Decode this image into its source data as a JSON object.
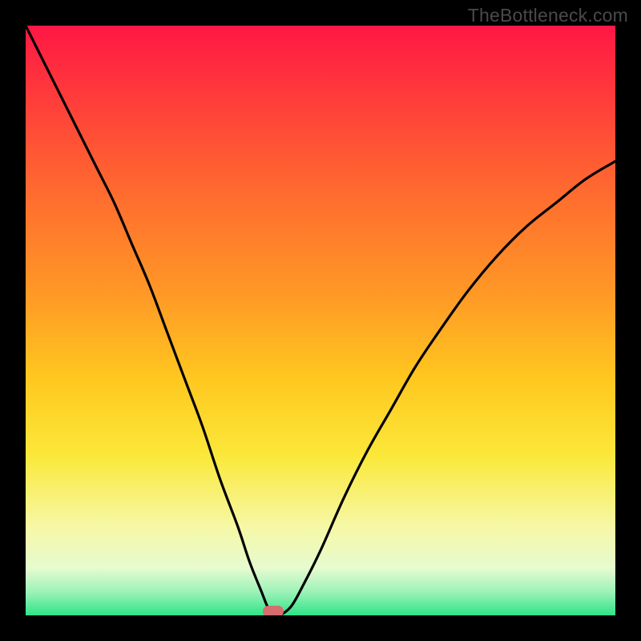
{
  "watermark": "TheBottleneck.com",
  "chart_data": {
    "type": "line",
    "title": "",
    "xlabel": "",
    "ylabel": "",
    "xlim": [
      0,
      100
    ],
    "ylim": [
      0,
      100
    ],
    "grid": false,
    "bottleneck_x": 42,
    "marker": {
      "x": 42,
      "y": 0,
      "color": "#d66e6e"
    },
    "gradient_stops": [
      {
        "pos": 0.0,
        "color": "#ff1744"
      },
      {
        "pos": 0.12,
        "color": "#ff3b3b"
      },
      {
        "pos": 0.28,
        "color": "#ff6a2f"
      },
      {
        "pos": 0.45,
        "color": "#ff9726"
      },
      {
        "pos": 0.6,
        "color": "#ffc81f"
      },
      {
        "pos": 0.73,
        "color": "#fbe83a"
      },
      {
        "pos": 0.85,
        "color": "#f6f8a6"
      },
      {
        "pos": 0.92,
        "color": "#e6fbcf"
      },
      {
        "pos": 0.96,
        "color": "#9df2b9"
      },
      {
        "pos": 1.0,
        "color": "#2fe487"
      }
    ],
    "series": [
      {
        "name": "bottleneck-curve",
        "x": [
          0,
          3,
          6,
          9,
          12,
          15,
          18,
          21,
          24,
          27,
          30,
          33,
          36,
          38,
          40,
          41,
          42,
          43,
          45,
          47,
          50,
          54,
          58,
          62,
          66,
          70,
          75,
          80,
          85,
          90,
          95,
          100
        ],
        "y": [
          100,
          94,
          88,
          82,
          76,
          70,
          63,
          56,
          48,
          40,
          32,
          23,
          15,
          9,
          4,
          1.5,
          0,
          0,
          1.5,
          5,
          11,
          20,
          28,
          35,
          42,
          48,
          55,
          61,
          66,
          70,
          74,
          77
        ]
      }
    ]
  }
}
